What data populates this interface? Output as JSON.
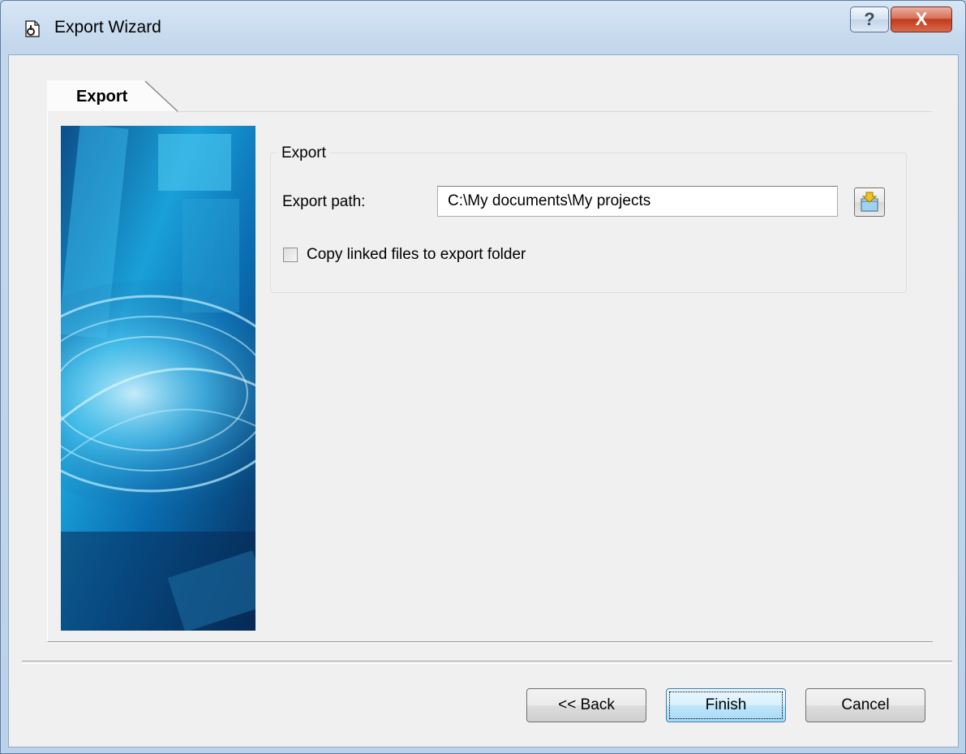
{
  "window": {
    "title": "Export Wizard",
    "icon": "export-wizard-icon",
    "help_glyph": "?",
    "close_glyph": "X"
  },
  "tabs": [
    {
      "label": "Export",
      "selected": true
    }
  ],
  "export_group": {
    "title": "Export",
    "path_label": "Export path:",
    "path_value": "C:\\My documents\\My projects",
    "browse_icon": "folder-browse-icon",
    "copy_linked_label": "Copy linked files to export folder",
    "copy_linked_checked": false
  },
  "buttons": {
    "back": "<< Back",
    "finish": "Finish",
    "cancel": "Cancel"
  }
}
